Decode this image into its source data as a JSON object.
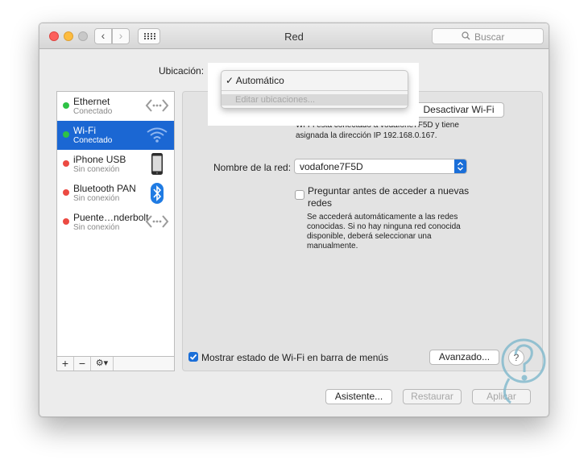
{
  "window": {
    "title": "Red"
  },
  "search": {
    "placeholder": "Buscar"
  },
  "location": {
    "label": "Ubicación:",
    "menu": {
      "selected": "Automático",
      "edit": "Editar ubicaciones..."
    }
  },
  "services": [
    {
      "name": "Ethernet",
      "status": "Conectado",
      "dot_color": "#2ec245",
      "icon": "ethernet-icon",
      "selected": false
    },
    {
      "name": "Wi-Fi",
      "status": "Conectado",
      "dot_color": "#2ec245",
      "icon": "wifi-icon",
      "selected": true
    },
    {
      "name": "iPhone USB",
      "status": "Sin conexión",
      "dot_color": "#ec4a42",
      "icon": "iphone-icon",
      "selected": false
    },
    {
      "name": "Bluetooth PAN",
      "status": "Sin conexión",
      "dot_color": "#ec4a42",
      "icon": "bluetooth-icon",
      "selected": false
    },
    {
      "name": "Puente…nderbolt",
      "status": "Sin conexión",
      "dot_color": "#ec4a42",
      "icon": "thunderbolt-bridge-icon",
      "selected": false
    }
  ],
  "sidebar_footer": {
    "add": "+",
    "remove": "−",
    "action": "⚙▾"
  },
  "wifi": {
    "toggle_button": "Desactivar Wi-Fi",
    "status_line1": "Wi-Fi está conectado a vodafone7F5D y tiene",
    "status_line2": "asignada la dirección IP 192.168.0.167.",
    "network_label": "Nombre de la red:",
    "network_value": "vodafone7F5D",
    "ask_label": "Preguntar antes de acceder a nuevas redes",
    "ask_checked": false,
    "ask_hint": "Se accederá automáticamente a las redes conocidas. Si no hay ninguna red conocida disponible, deberá seleccionar una manualmente.",
    "show_status_label": "Mostrar estado de Wi-Fi en barra de menús",
    "show_status_checked": true,
    "advanced_button": "Avanzado...",
    "help": "?"
  },
  "footer": {
    "assistant": "Asistente...",
    "revert": "Restaurar",
    "apply": "Aplicar"
  },
  "colors": {
    "selection": "#1b67d3",
    "accent": "#1a6ed8",
    "connected": "#2ec245",
    "disconnected": "#ec4a42"
  }
}
